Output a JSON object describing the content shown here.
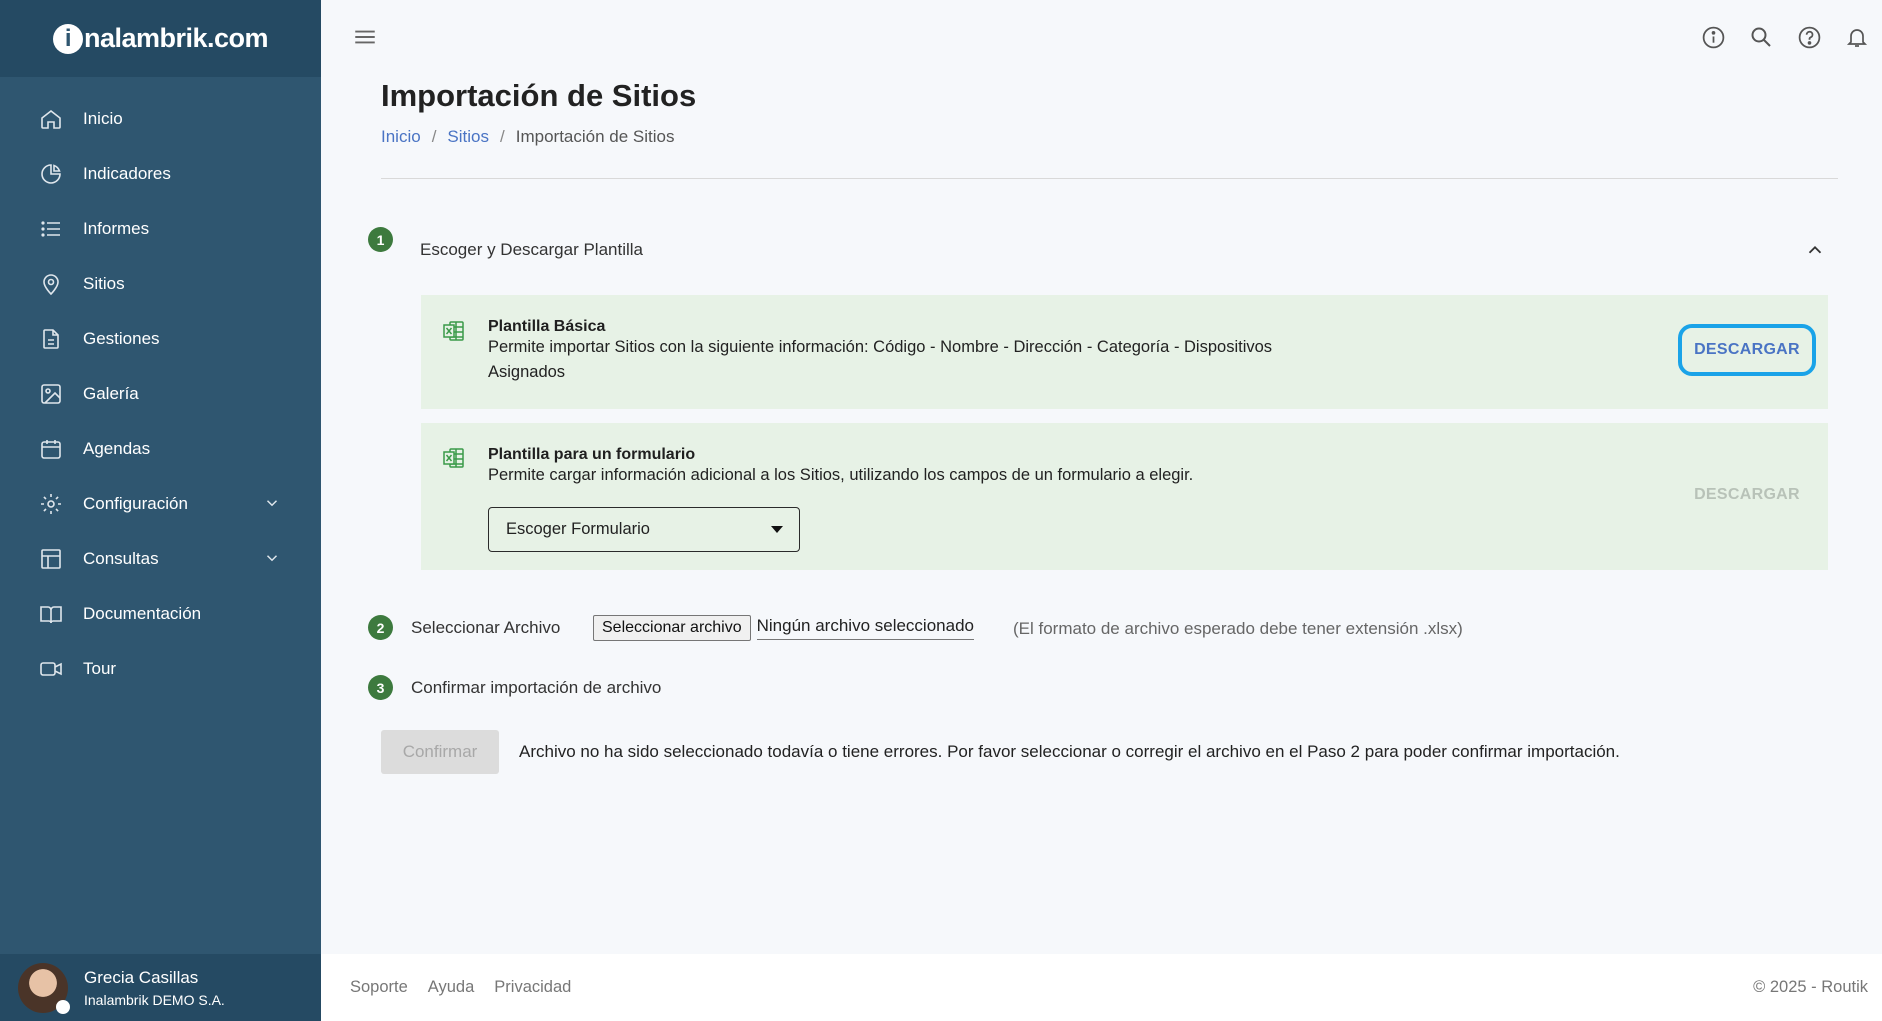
{
  "brand": {
    "logo_mark": "i",
    "logo_text": "nalambrik.com"
  },
  "sidebar": {
    "items": [
      {
        "label": "Inicio",
        "icon": "home-icon"
      },
      {
        "label": "Indicadores",
        "icon": "pie-chart-icon"
      },
      {
        "label": "Informes",
        "icon": "list-icon"
      },
      {
        "label": "Sitios",
        "icon": "map-pin-icon"
      },
      {
        "label": "Gestiones",
        "icon": "file-icon"
      },
      {
        "label": "Galería",
        "icon": "image-icon"
      },
      {
        "label": "Agendas",
        "icon": "calendar-icon"
      },
      {
        "label": "Configuración",
        "icon": "gear-icon",
        "expandable": true
      },
      {
        "label": "Consultas",
        "icon": "table-icon",
        "expandable": true
      },
      {
        "label": "Documentación",
        "icon": "book-icon"
      },
      {
        "label": "Tour",
        "icon": "video-icon"
      }
    ],
    "user": {
      "name": "Grecia Casillas",
      "company": "Inalambrik DEMO S.A."
    }
  },
  "topbar": {
    "icons": [
      "info-icon",
      "search-icon",
      "help-icon",
      "bell-icon"
    ]
  },
  "page": {
    "title": "Importación de Sitios",
    "breadcrumb": [
      "Inicio",
      "Sitios",
      "Importación de Sitios"
    ]
  },
  "steps": {
    "step1": {
      "number": "1",
      "label": "Escoger y Descargar Plantilla",
      "templates": [
        {
          "title": "Plantilla Básica",
          "description": "Permite importar Sitios con la siguiente información: Código - Nombre - Dirección - Categoría - Dispositivos Asignados",
          "button": "DESCARGAR"
        },
        {
          "title": "Plantilla para un formulario",
          "description": "Permite cargar información adicional a los Sitios, utilizando los campos de un formulario a elegir.",
          "select_value": "Escoger Formulario",
          "button": "DESCARGAR"
        }
      ]
    },
    "step2": {
      "number": "2",
      "label": "Seleccionar Archivo",
      "file_button": "Seleccionar archivo",
      "file_name": "Ningún archivo seleccionado",
      "hint": "(El formato de archivo esperado debe tener extensión .xlsx)"
    },
    "step3": {
      "number": "3",
      "label": "Confirmar importación de archivo",
      "confirm_button": "Confirmar",
      "message": "Archivo no ha sido seleccionado todavía o tiene errores. Por favor seleccionar o corregir el archivo en el Paso 2 para poder confirmar importación."
    }
  },
  "footer": {
    "links": [
      "Soporte",
      "Ayuda",
      "Privacidad"
    ],
    "copyright": "© 2025 - Routik"
  },
  "colors": {
    "sidebar": "#2f5670",
    "sidebar_dark": "#254a63",
    "accent": "#4a74c4",
    "step_green": "#3d7a3e",
    "card_bg": "#e7f2e6",
    "focus_ring": "#1aa3e8"
  }
}
